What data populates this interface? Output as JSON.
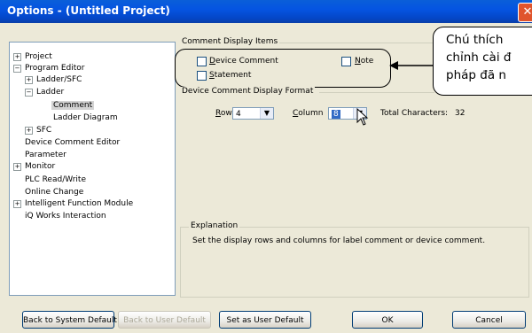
{
  "window": {
    "title": "Options - (Untitled Project)",
    "close_glyph": "✕"
  },
  "tree": {
    "expand_glyph": "+",
    "collapse_glyph": "−",
    "items": [
      {
        "label": "Project"
      },
      {
        "label": "Program Editor"
      },
      {
        "label": "Ladder/SFC"
      },
      {
        "label": "Ladder"
      },
      {
        "label": "Comment"
      },
      {
        "label": "Ladder Diagram"
      },
      {
        "label": "SFC"
      },
      {
        "label": "Device Comment Editor"
      },
      {
        "label": "Parameter"
      },
      {
        "label": "Monitor"
      },
      {
        "label": "PLC Read/Write"
      },
      {
        "label": "Online Change"
      },
      {
        "label": "Intelligent Function Module"
      },
      {
        "label": "iQ Works Interaction"
      }
    ]
  },
  "comment_items": {
    "group_label": "Comment Display Items",
    "device_comment": {
      "underline": "D",
      "rest": "evice Comment",
      "checked": false
    },
    "note": {
      "underline": "N",
      "rest": "ote",
      "checked": false
    },
    "statement": {
      "underline": "S",
      "rest": "tatement",
      "checked": false
    }
  },
  "format": {
    "group_label": "Device Comment Display Format",
    "row_label_u": "R",
    "row_label_rest": "ow",
    "row_value": "4",
    "column_label_u": "C",
    "column_label_rest": "olumn",
    "column_value": "8",
    "dropdown_glyph": "▼",
    "total_label": "Total Characters:",
    "total_value": "32"
  },
  "explanation": {
    "label": "Explanation",
    "text": "Set the display rows and columns for label comment or device comment."
  },
  "buttons": {
    "system_default": "Back to System Default",
    "user_default_back": "Back to User Default",
    "set_user_default": "Set as User Default",
    "ok": "OK",
    "cancel": "Cancel"
  },
  "callout": {
    "line1": "Chú thích",
    "line2": "chỉnh cài đ",
    "line3": "pháp đã n"
  },
  "colors": {
    "title_bar": "#0554e2",
    "window_bg": "#ece9d8",
    "close_button": "#e0542c"
  }
}
